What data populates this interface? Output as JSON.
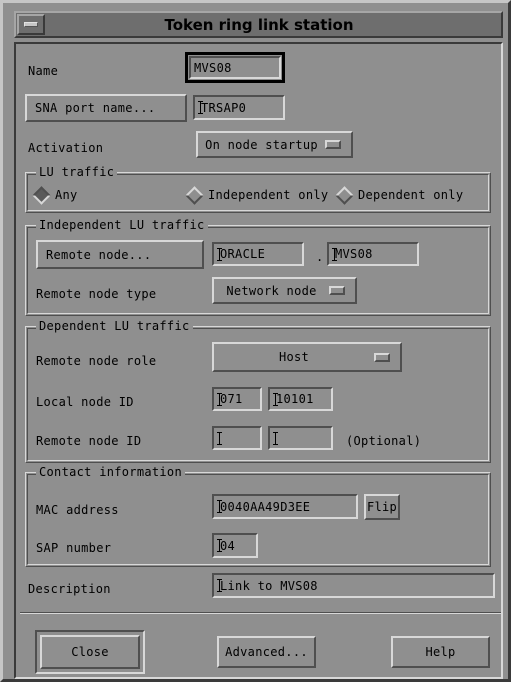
{
  "window": {
    "title": "Token ring link station",
    "minimize_icon": "minimize-icon"
  },
  "form": {
    "name_label": "Name",
    "name_value": "MVS08",
    "sna_port_button": "SNA port name...",
    "sna_port_value": "TRSAP0",
    "activation_label": "Activation",
    "activation_value": "On node startup",
    "lu_traffic": {
      "title": "LU traffic",
      "options": [
        {
          "label": "Any",
          "selected": true
        },
        {
          "label": "Independent only",
          "selected": false
        },
        {
          "label": "Dependent only",
          "selected": false
        }
      ]
    },
    "independent": {
      "title": "Independent LU traffic",
      "remote_node_button": "Remote node...",
      "remote_net_value": "ORACLE",
      "separator": ".",
      "remote_name_value": "MVS08",
      "remote_node_type_label": "Remote node type",
      "remote_node_type_value": "Network node"
    },
    "dependent": {
      "title": "Dependent LU traffic",
      "remote_node_role_label": "Remote node role",
      "remote_node_role_value": "Host",
      "local_node_id_label": "Local node ID",
      "local_node_id_1": "071",
      "local_node_id_2": "10101",
      "remote_node_id_label": "Remote node ID",
      "remote_node_id_1": "",
      "remote_node_id_2": "",
      "optional_label": "(Optional)"
    },
    "contact": {
      "title": "Contact information",
      "mac_label": "MAC address",
      "mac_value": "0040AA49D3EE",
      "flip_button": "Flip",
      "sap_label": "SAP number",
      "sap_value": "04"
    },
    "description_label": "Description",
    "description_value": "Link to MVS08"
  },
  "actions": {
    "close": "Close",
    "advanced": "Advanced...",
    "help": "Help"
  }
}
